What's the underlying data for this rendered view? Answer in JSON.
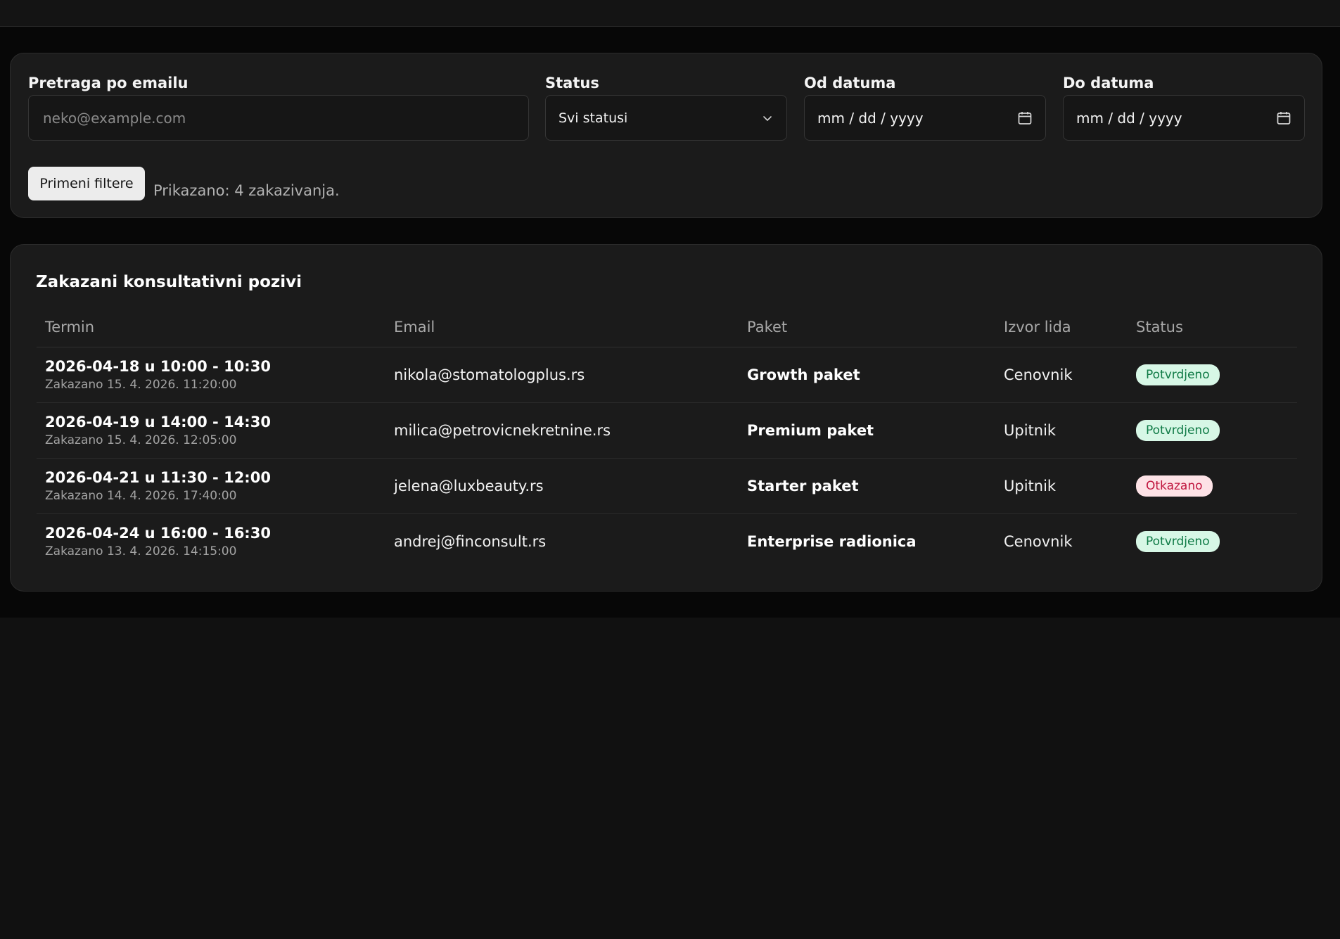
{
  "filters": {
    "email_label": "Pretraga po emailu",
    "email_placeholder": "neko@example.com",
    "status_label": "Status",
    "status_value": "Svi statusi",
    "from_label": "Od datuma",
    "from_placeholder": "mm / dd / yyyy",
    "to_label": "Do datuma",
    "to_placeholder": "mm / dd / yyyy",
    "apply_label": "Primeni filtere",
    "summary": "Prikazano: 4 zakazivanja."
  },
  "table": {
    "title": "Zakazani konsultativni pozivi",
    "headers": {
      "termin": "Termin",
      "email": "Email",
      "paket": "Paket",
      "izvor": "Izvor lida",
      "status": "Status"
    },
    "rows": [
      {
        "slot": "2026-04-18 u 10:00 - 10:30",
        "booked": "Zakazano 15. 4. 2026. 11:20:00",
        "email": "nikola@stomatologplus.rs",
        "package": "Growth paket",
        "source": "Cenovnik",
        "status": "Potvrdjeno"
      },
      {
        "slot": "2026-04-19 u 14:00 - 14:30",
        "booked": "Zakazano 15. 4. 2026. 12:05:00",
        "email": "milica@petrovicnekretnine.rs",
        "package": "Premium paket",
        "source": "Upitnik",
        "status": "Potvrdjeno"
      },
      {
        "slot": "2026-04-21 u 11:30 - 12:00",
        "booked": "Zakazano 14. 4. 2026. 17:40:00",
        "email": "jelena@luxbeauty.rs",
        "package": "Starter paket",
        "source": "Upitnik",
        "status": "Otkazano"
      },
      {
        "slot": "2026-04-24 u 16:00 - 16:30",
        "booked": "Zakazano 13. 4. 2026. 14:15:00",
        "email": "andrej@finconsult.rs",
        "package": "Enterprise radionica",
        "source": "Cenovnik",
        "status": "Potvrdjeno"
      }
    ]
  },
  "icons": {
    "select_arrow": "chevron-down-icon",
    "date_picker": "calendar-icon"
  },
  "colors": {
    "confirmed_bg": "#d7f7e6",
    "confirmed_text": "#0f7a46",
    "cancelled_bg": "#fde2e6",
    "cancelled_text": "#c0163f"
  }
}
